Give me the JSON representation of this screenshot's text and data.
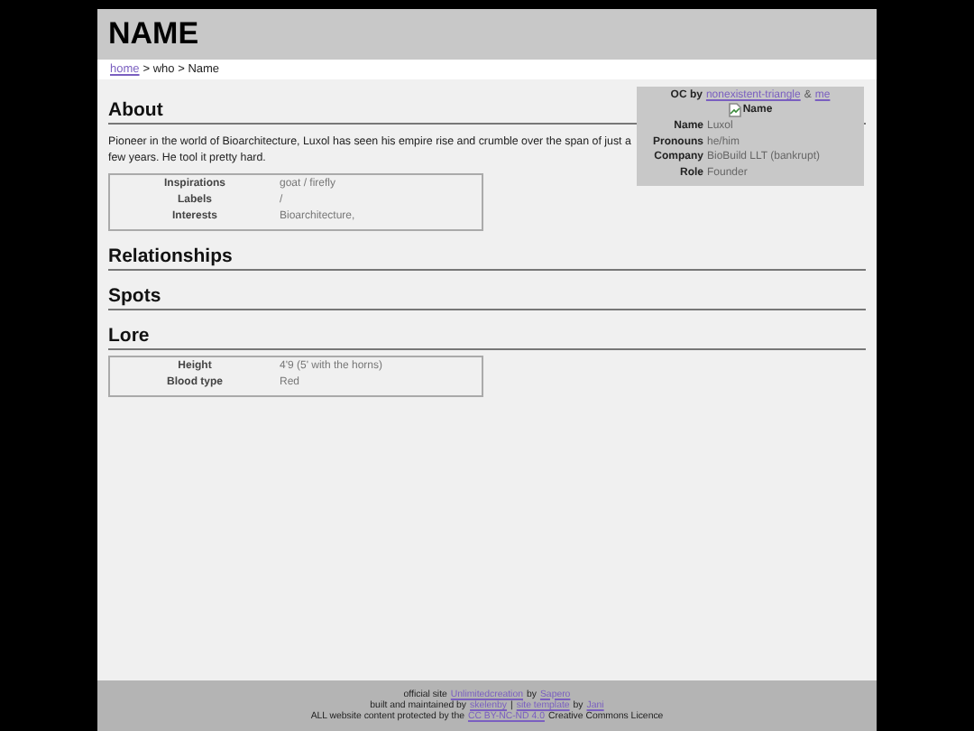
{
  "title": "NAME",
  "breadcrumb": [
    {
      "text": "home",
      "kind": "link"
    },
    {
      "text": "> who > Name",
      "kind": "text"
    }
  ],
  "infobox": {
    "credit": [
      {
        "text": "OC by",
        "kind": "bold"
      },
      {
        "text": "nonexistent-triangle",
        "kind": "link"
      },
      {
        "text": "&",
        "kind": "text"
      },
      {
        "text": "me",
        "kind": "link"
      }
    ],
    "image_alt": "Name",
    "rows": [
      {
        "label": "Name",
        "value": "Luxol"
      },
      {
        "label": "Pronouns",
        "value": "he/him"
      },
      {
        "label": "Company",
        "value": "BioBuild LLT (bankrupt)"
      },
      {
        "label": "Role",
        "value": "Founder"
      }
    ]
  },
  "sections": [
    {
      "heading": "About",
      "text": "Pioneer in the world of Bioarchitecture, Luxol has seen his empire rise and crumble over the span of just a few years. He tool it pretty hard.",
      "rows": [
        {
          "label": "Inspirations",
          "value": "goat / firefly"
        },
        {
          "label": "Labels",
          "value": "/"
        },
        {
          "label": "Interests",
          "value": "Bioarchitecture,"
        }
      ]
    },
    {
      "heading": "Relationships"
    },
    {
      "heading": "Spots"
    },
    {
      "heading": "Lore",
      "rows": [
        {
          "label": "Height",
          "value": "4'9 (5' with the horns)"
        },
        {
          "label": "Blood type",
          "value": "Red"
        }
      ]
    }
  ],
  "footer": [
    [
      {
        "text": "official site",
        "kind": "text"
      },
      {
        "text": "Unlimitedcreation",
        "kind": "link"
      },
      {
        "text": "by",
        "kind": "text"
      },
      {
        "text": "Sapero",
        "kind": "link"
      }
    ],
    [
      {
        "text": "built and maintained by",
        "kind": "text"
      },
      {
        "text": "skelenby",
        "kind": "link"
      },
      {
        "text": "|",
        "kind": "text"
      },
      {
        "text": "site template",
        "kind": "link"
      },
      {
        "text": "by",
        "kind": "text"
      },
      {
        "text": "Jani",
        "kind": "link"
      }
    ],
    [
      {
        "text": "ALL website content protected by the",
        "kind": "text"
      },
      {
        "text": "CC BY-NC-ND 4.0",
        "kind": "link"
      },
      {
        "text": "Creative Commons Licence",
        "kind": "text"
      }
    ]
  ]
}
